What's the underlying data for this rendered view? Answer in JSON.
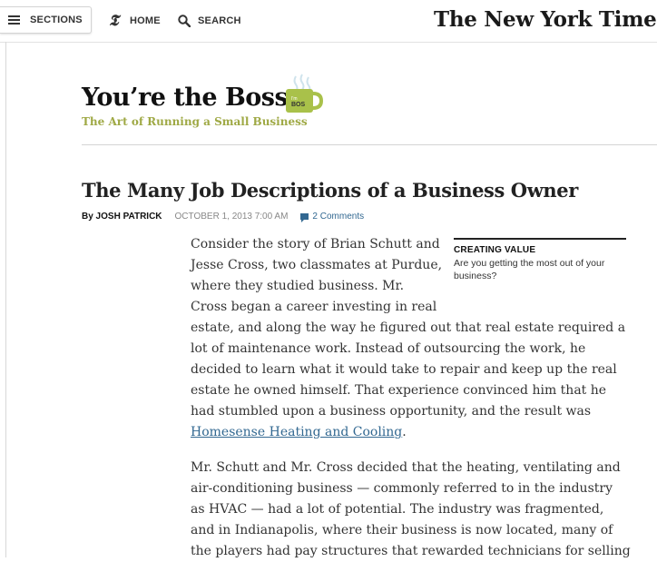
{
  "topnav": {
    "sections_label": "SECTIONS",
    "home_label": "HOME",
    "search_label": "SEARCH",
    "logo_text": "The New York Times"
  },
  "blog": {
    "title": "You’re the Boss",
    "tagline": "The Art of Running a Small Business",
    "mug_label": "BOS"
  },
  "article": {
    "headline": "The Many Job Descriptions of a Business Owner",
    "byline": "By JOSH PATRICK",
    "date": "OCTOBER 1, 2013 7:00 AM",
    "comments": "2 Comments",
    "para1_lines": [
      "Consider the story of Brian Schutt and",
      "Jesse Cross, two classmates at Purdue,",
      "where they studied business. Mr.",
      "Cross began a career investing in real",
      "estate, and along the way he figured out that real estate required a",
      "lot of maintenance work. Instead of outsourcing the work, he",
      "decided to learn what it would take to repair and keep up the real",
      "estate he owned himself. That experience convinced him that he",
      "had stumbled upon a business opportunity, and the result was"
    ],
    "para1_link": "Homesense Heating and Cooling",
    "para1_end": ".",
    "para2_lines": [
      "Mr. Schutt and Mr. Cross decided that the heating, ventilating and",
      "air-conditioning business — commonly referred to in the industry",
      "as HVAC — had a lot of potential. The industry was fragmented,",
      "and in Indianapolis, where their business is now located, many of",
      "the players had pay structures that rewarded technicians for selling"
    ]
  },
  "sidebar": {
    "heading": "CREATING VALUE",
    "text": "Are you getting the most out of your business?"
  },
  "colors": {
    "link": "#326891",
    "tagline": "#9fa945",
    "mug": "#a9c14a"
  },
  "icons": [
    "hamburger-icon",
    "nyt-t-icon",
    "search-icon",
    "comment-icon",
    "coffee-mug-icon"
  ]
}
